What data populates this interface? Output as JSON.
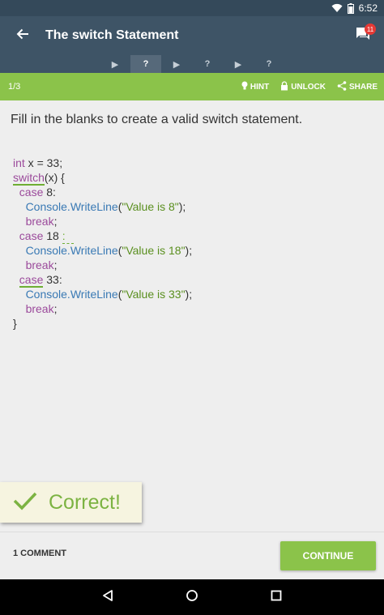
{
  "status_bar": {
    "time": "6:52"
  },
  "app_bar": {
    "title": "The switch Statement",
    "comment_count": "11"
  },
  "progress": {
    "steps": [
      {
        "symbol": "▶",
        "active": false
      },
      {
        "symbol": "?",
        "active": true
      },
      {
        "symbol": "▶",
        "active": false
      },
      {
        "symbol": "?",
        "active": false
      },
      {
        "symbol": "▶",
        "active": false
      },
      {
        "symbol": "?",
        "active": false
      }
    ]
  },
  "lesson_bar": {
    "counter": "1/3",
    "hint": "HINT",
    "unlock": "UNLOCK",
    "share": "SHARE"
  },
  "question": "Fill in the blanks to create a valid switch statement.",
  "code": {
    "l1_kw": "int",
    "l1_rest": " x = 33;",
    "l2_blank": "switch",
    "l2_rest": "(x) {",
    "l3_indent": "  ",
    "l3_kw": "case",
    "l3_rest": " 8:",
    "l4_indent": "    ",
    "l4_fn": "Console.WriteLine",
    "l4_open": "(",
    "l4_str": "\"Value is 8\"",
    "l4_close": ");",
    "l5_indent": "    ",
    "l5_kw": "break",
    "l5_rest": ";",
    "l6_indent": "  ",
    "l6_kw": "case",
    "l6_rest": " 18 ",
    "l6_blank": ":",
    "l7_indent": "    ",
    "l7_fn": "Console.WriteLine",
    "l7_open": "(",
    "l7_str": "\"Value is 18\"",
    "l7_close": ");",
    "l8_indent": "    ",
    "l8_kw": "break",
    "l8_rest": ";",
    "l9_indent": "  ",
    "l9_blank": "case",
    "l9_rest": " 33:",
    "l10_indent": "    ",
    "l10_fn": "Console.WriteLine",
    "l10_open": "(",
    "l10_str": "\"Value is 33\"",
    "l10_close": ");",
    "l11_indent": "    ",
    "l11_kw": "break",
    "l11_rest": ";",
    "l12": "}"
  },
  "feedback": {
    "text": "Correct!"
  },
  "footer": {
    "comments_label": "1 COMMENT",
    "continue_label": "CONTINUE"
  },
  "colors": {
    "primary": "#3e5466",
    "accent": "#8bc34a",
    "keyword": "#9b4a9b",
    "function": "#3979b4",
    "string": "#5a8f1f"
  }
}
